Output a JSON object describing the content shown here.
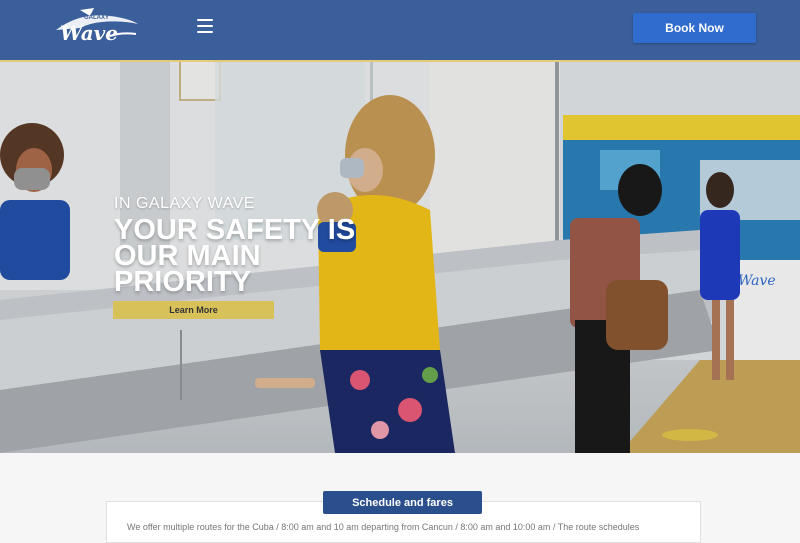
{
  "header": {
    "logo_text": "GALAXY Wave",
    "menu_icon": "hamburger-menu-icon",
    "book_button": "Book Now"
  },
  "hero": {
    "eyebrow": "IN GALAXY WAVE",
    "headline_line1": "YOUR SAFETY IS",
    "headline_line2": "OUR MAIN",
    "headline_line3": "PRIORITY",
    "cta": "Learn More",
    "sign_text": "Wave"
  },
  "section": {
    "schedule_button": "Schedule and fares",
    "intro_text": "We offer multiple routes for the Cuba / 8:00 am and 10 am departing from Cancun / 8:00 am and 10:00 am / The route schedules"
  },
  "colors": {
    "header_bg": "#3b5f9a",
    "book_button": "#2f6ccd",
    "cta_button": "#d9c15a",
    "schedule_button": "#2a4f8c"
  }
}
